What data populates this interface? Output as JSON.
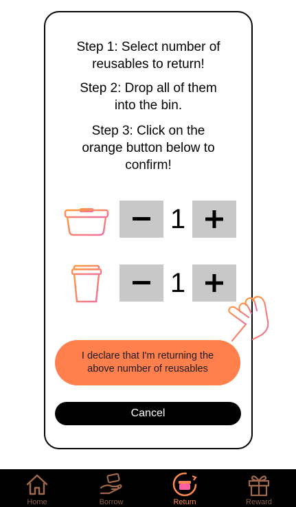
{
  "instructions": {
    "step1": [
      "Step 1: Select number of",
      "reusables to return!"
    ],
    "step2": [
      "Step 2: Drop all of them",
      "into the bin."
    ],
    "step3": [
      "Step 3: Click on the",
      "orange button below to",
      "confirm!"
    ]
  },
  "items": [
    {
      "icon": "container-icon",
      "quantity": "1",
      "minus": "−",
      "plus": "+"
    },
    {
      "icon": "cup-icon",
      "quantity": "1",
      "minus": "−",
      "plus": "+"
    }
  ],
  "declare_button": [
    "I declare that I'm returning the",
    "above number of reusables"
  ],
  "cancel_button": "Cancel",
  "tabs": [
    {
      "label": "Home",
      "icon": "home-icon"
    },
    {
      "label": "Borrow",
      "icon": "borrow-icon"
    },
    {
      "label": "Return",
      "icon": "return-icon",
      "active": true
    },
    {
      "label": "Reward",
      "icon": "gift-icon"
    }
  ],
  "colors": {
    "accent": "#ff7f4d",
    "gradient_start": "#ff9a3c",
    "gradient_end": "#f06fa0",
    "button_gray": "#c8c8c8"
  }
}
